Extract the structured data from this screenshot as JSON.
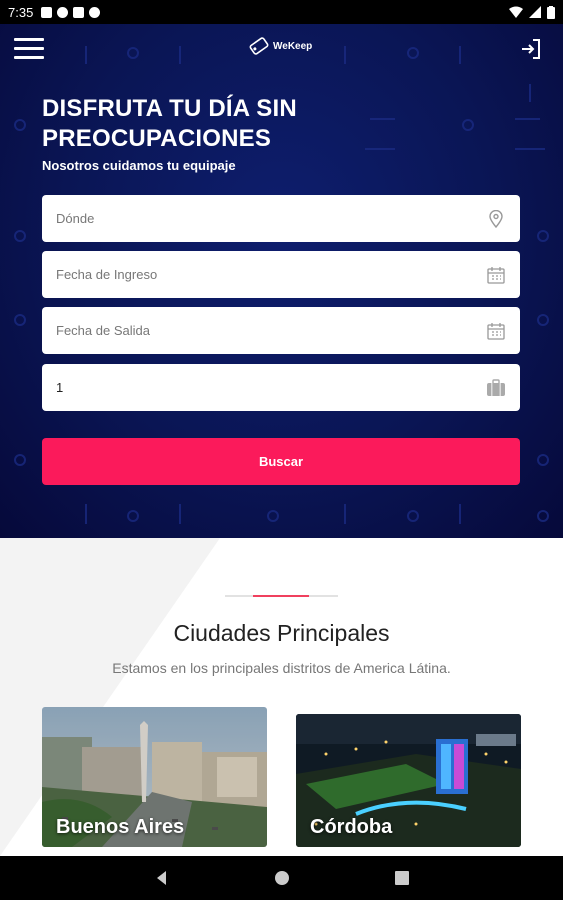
{
  "status_bar": {
    "time": "7:35"
  },
  "header": {
    "brand": "WeKeep"
  },
  "hero": {
    "title": "DISFRUTA TU DÍA SIN PREOCUPACIONES",
    "subtitle": "Nosotros cuidamos tu equipaje"
  },
  "form": {
    "where_placeholder": "Dónde",
    "checkin_placeholder": "Fecha de Ingreso",
    "checkout_placeholder": "Fecha de Salida",
    "bags_value": "1",
    "search_label": "Buscar"
  },
  "cities_section": {
    "title": "Ciudades Principales",
    "subtitle": "Estamos en los principales distritos de America Látina.",
    "cities": [
      {
        "name": "Buenos Aires"
      },
      {
        "name": "Córdoba"
      }
    ]
  },
  "colors": {
    "accent": "#fb1a5b",
    "hero_bg": "#0a1554"
  }
}
